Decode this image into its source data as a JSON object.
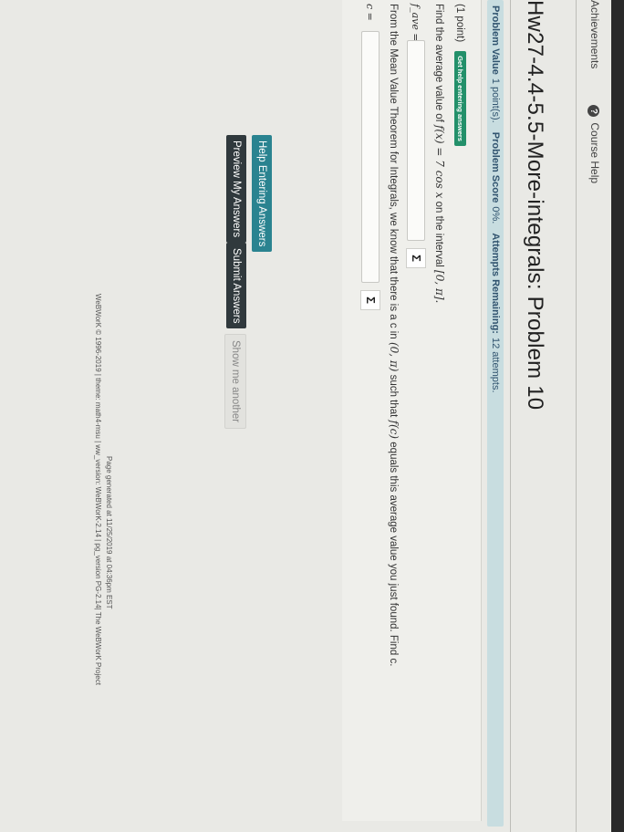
{
  "nav": {
    "achievements": "Achievements",
    "course_help": "Course Help"
  },
  "title": "Hw27-4.4-5.5-More-integrals: Problem 10",
  "info": {
    "value_label": "Problem Value",
    "value": "1 point(s).",
    "score_label": "Problem Score",
    "score": "0%.",
    "attempts_label": "Attempts Remaining:",
    "attempts": "12 attempts."
  },
  "problem": {
    "points": "(1 point)",
    "help_button": "Get help entering answers",
    "question1_pre": "Find the average value of",
    "question1_func": "f(x) = 7 cos x",
    "question1_mid": "on the interval",
    "question1_interval": "[0, π].",
    "answer1_label": "f_ave =",
    "answer1_value": "",
    "question2_pre": "From the Mean Value Theorem for Integrals, we know that there is a c in",
    "question2_interval": "(0, π)",
    "question2_mid": "such that",
    "question2_func": "f(c)",
    "question2_post": "equals this average value you just found. Find c.",
    "answer2_label": "c =",
    "answer2_value": "",
    "sigma": "Σ"
  },
  "buttons": {
    "help_entering": "Help Entering Answers",
    "preview": "Preview My Answers",
    "submit": "Submit Answers",
    "show_another": "Show me another"
  },
  "footer": {
    "generated": "Page generated at 11/25/2019 at 04:36pm EST",
    "copyright": "WeBWorK © 1996-2019 | theme: math4-msu | ww_version: WeBWorK-2.14 | pg_version PG-2.14| The WeBWorK Project"
  },
  "colors": {
    "info_bar": "#c8dde0",
    "help_button": "#23906a",
    "teal_button": "#2a8390",
    "dark_button": "#30393d"
  }
}
